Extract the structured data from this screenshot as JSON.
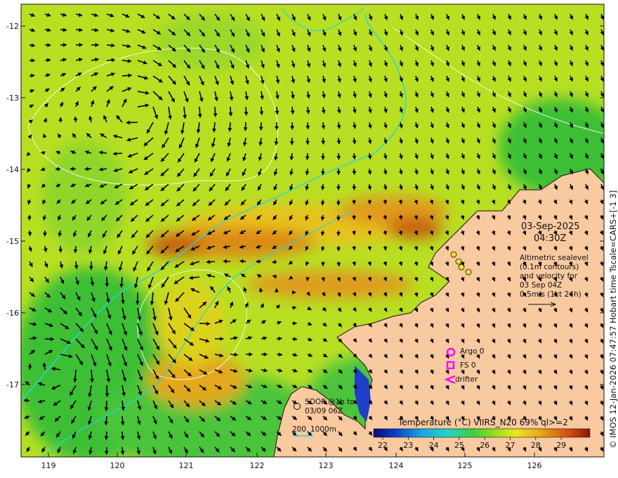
{
  "map": {
    "date": "03-Sep-2025",
    "time": "04:30Z",
    "altimetry_lines": [
      "Altimetric sealevel",
      "(0.1m contours)",
      "and velocity for",
      "03 Sep 04Z",
      "0.5m/s (1kt 24h)"
    ],
    "lat_ticks": [
      "-12",
      "-13",
      "-14",
      "-15",
      "-16",
      "-17"
    ],
    "lon_ticks": [
      "119",
      "120",
      "121",
      "122",
      "123",
      "124",
      "125",
      "126"
    ],
    "copyright": "© IMOS 12-Jan-2026 07:47:57 Hobart time Tscale=CARS+[-1 3]",
    "legend": {
      "argo": "Argo 0",
      "fs": "FS 0",
      "drifter": "drifter",
      "soop_line1": "SOOP @1h to",
      "soop_line2": "03/09 06Z",
      "contour_200": "200",
      "contour_1000": "1000m"
    },
    "colorbar": {
      "title": "Temperature (°C) VIIRS_N20 69% ql>=2",
      "ticks": [
        "22",
        "23",
        "24",
        "25",
        "26",
        "27",
        "28",
        "29"
      ]
    },
    "colors": {
      "land": "#f9c9a0",
      "sst_green": "#3fbf3a",
      "sst_yellow": "#c6e21c",
      "sst_orange": "#e4961a",
      "bathy_cyan": "#22d8d8",
      "argo_magenta": "#ff00ff"
    }
  }
}
